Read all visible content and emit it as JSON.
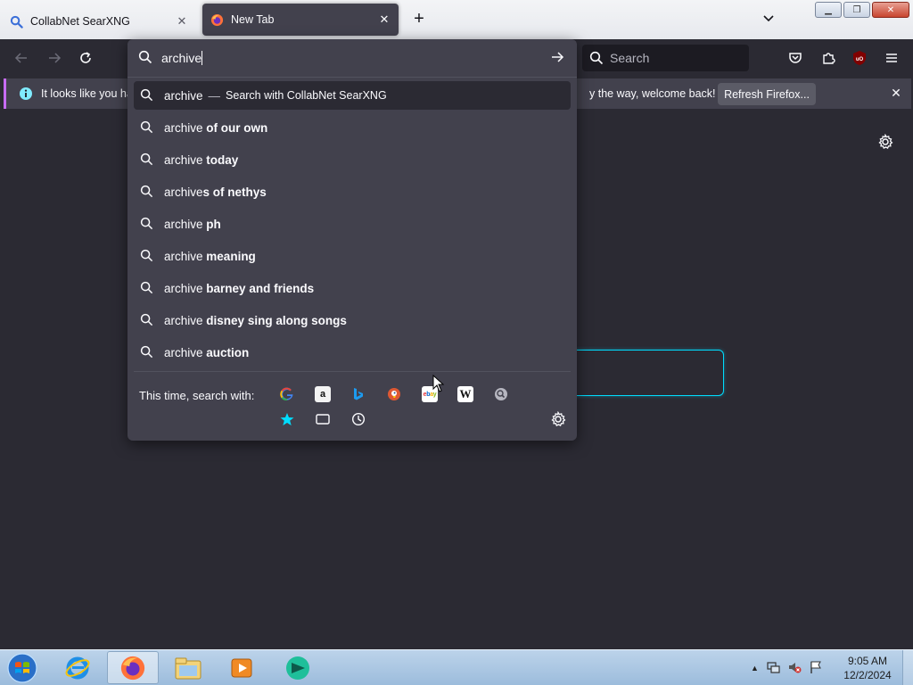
{
  "tabs": [
    {
      "title": "CollabNet SearXNG",
      "active": false
    },
    {
      "title": "New Tab",
      "active": true
    }
  ],
  "toolbar": {
    "search_placeholder": "Search"
  },
  "notice": {
    "text_left": "It looks like you ha",
    "text_right": "y the way, welcome back!",
    "refresh_label": "Refresh Firefox..."
  },
  "urlbar": {
    "typed": "archive",
    "first_result": {
      "prefix": "archive",
      "dash": "—",
      "action": "Search with CollabNet SearXNG"
    },
    "suggestions": [
      {
        "prefix": "archive",
        "suffix": "of our own"
      },
      {
        "prefix": "archive",
        "suffix": "today"
      },
      {
        "prefix": "archive",
        "suffix": "s of nethys"
      },
      {
        "prefix": "archive",
        "suffix": "ph"
      },
      {
        "prefix": "archive",
        "suffix": "meaning"
      },
      {
        "prefix": "archive",
        "suffix": "barney and friends"
      },
      {
        "prefix": "archive",
        "suffix": "disney sing along songs"
      },
      {
        "prefix": "archive",
        "suffix": "auction"
      }
    ],
    "oneoff_label": "This time, search with:",
    "engines": [
      "google-icon",
      "amazon-icon",
      "bing-icon",
      "duckduckgo-icon",
      "ebay-icon",
      "wikipedia-icon",
      "searxng-icon"
    ],
    "modes": [
      "bookmarks-icon",
      "tabs-icon",
      "history-icon"
    ]
  },
  "taskbar": {
    "time": "9:05 AM",
    "date": "12/2/2024"
  },
  "colors": {
    "accent_cyan": "#00ddff",
    "notice_stripe": "#c86cf5",
    "panel": "#42414d",
    "background": "#2b2a33"
  }
}
